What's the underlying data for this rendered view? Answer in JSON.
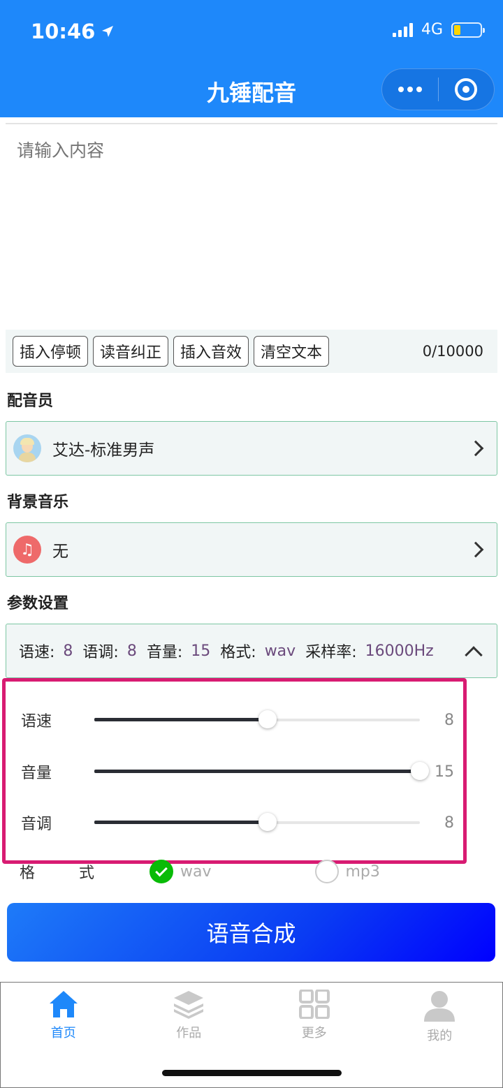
{
  "status_bar": {
    "time": "10:46",
    "network": "4G"
  },
  "nav": {
    "title": "九锤配音"
  },
  "editor": {
    "placeholder": "请输入内容",
    "value": ""
  },
  "toolbar": {
    "insert_pause": "插入停顿",
    "pronunciation_fix": "读音纠正",
    "insert_sfx": "插入音效",
    "clear_text": "清空文本",
    "counter": "0/10000"
  },
  "voice": {
    "section_label": "配音员",
    "selected": "艾达-标准男声"
  },
  "bgm": {
    "section_label": "背景音乐",
    "selected": "无"
  },
  "params": {
    "section_label": "参数设置",
    "speed_label": "语速:",
    "speed": "8",
    "tone_label": "语调:",
    "tone": "8",
    "volume_label": "音量:",
    "volume": "15",
    "format_label": "格式:",
    "format": "wav",
    "sample_rate_label": "采样率:",
    "sample_rate": "16000Hz"
  },
  "sliders": [
    {
      "label": "语速",
      "value": "8",
      "fraction": 0.533
    },
    {
      "label": "音量",
      "value": "15",
      "fraction": 1.0
    },
    {
      "label": "音调",
      "value": "8",
      "fraction": 0.533
    }
  ],
  "format": {
    "label": "格 式",
    "options": [
      "wav",
      "mp3"
    ],
    "selected": "wav"
  },
  "synthesize_button": "语音合成",
  "tabs": [
    {
      "label": "首页",
      "icon": "home-icon",
      "active": true
    },
    {
      "label": "作品",
      "icon": "layers-icon",
      "active": false
    },
    {
      "label": "更多",
      "icon": "grid-icon",
      "active": false
    },
    {
      "label": "我的",
      "icon": "user-icon",
      "active": false
    }
  ],
  "colors": {
    "primary": "#1e88fa",
    "highlight_border": "#d81b72",
    "radio_checked": "#09bb07",
    "param_value": "#6b4a7c"
  }
}
